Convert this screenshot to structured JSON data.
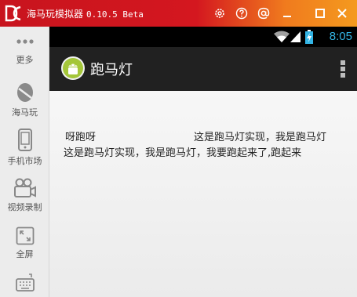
{
  "window": {
    "title": "海马玩模拟器",
    "version": "0.10.5 Beta",
    "controls": [
      "settings-icon",
      "help-icon",
      "account-icon",
      "minimize-icon",
      "maximize-icon",
      "close-icon"
    ]
  },
  "sidebar": {
    "items": [
      {
        "label": "更多",
        "icon": "more-icon"
      },
      {
        "label": "海马玩",
        "icon": "haimawan-icon"
      },
      {
        "label": "手机市场",
        "icon": "phone-market-icon"
      },
      {
        "label": "视频录制",
        "icon": "video-record-icon"
      },
      {
        "label": "全屏",
        "icon": "fullscreen-icon"
      },
      {
        "label": "",
        "icon": "keyboard-icon"
      }
    ]
  },
  "statusbar": {
    "time": "8:05"
  },
  "actionbar": {
    "title": "跑马灯"
  },
  "content": {
    "line1_left": "呀跑呀",
    "line1_right": "这是跑马灯实现，我是跑马灯",
    "line2": "这是跑马灯实现，我是跑马灯，我要跑起来了,跑起来"
  },
  "colors": {
    "titlebar_red": "#d4171f",
    "titlebar_orange": "#f49a1e",
    "clock": "#33b5e5",
    "actionbar": "#212121"
  }
}
